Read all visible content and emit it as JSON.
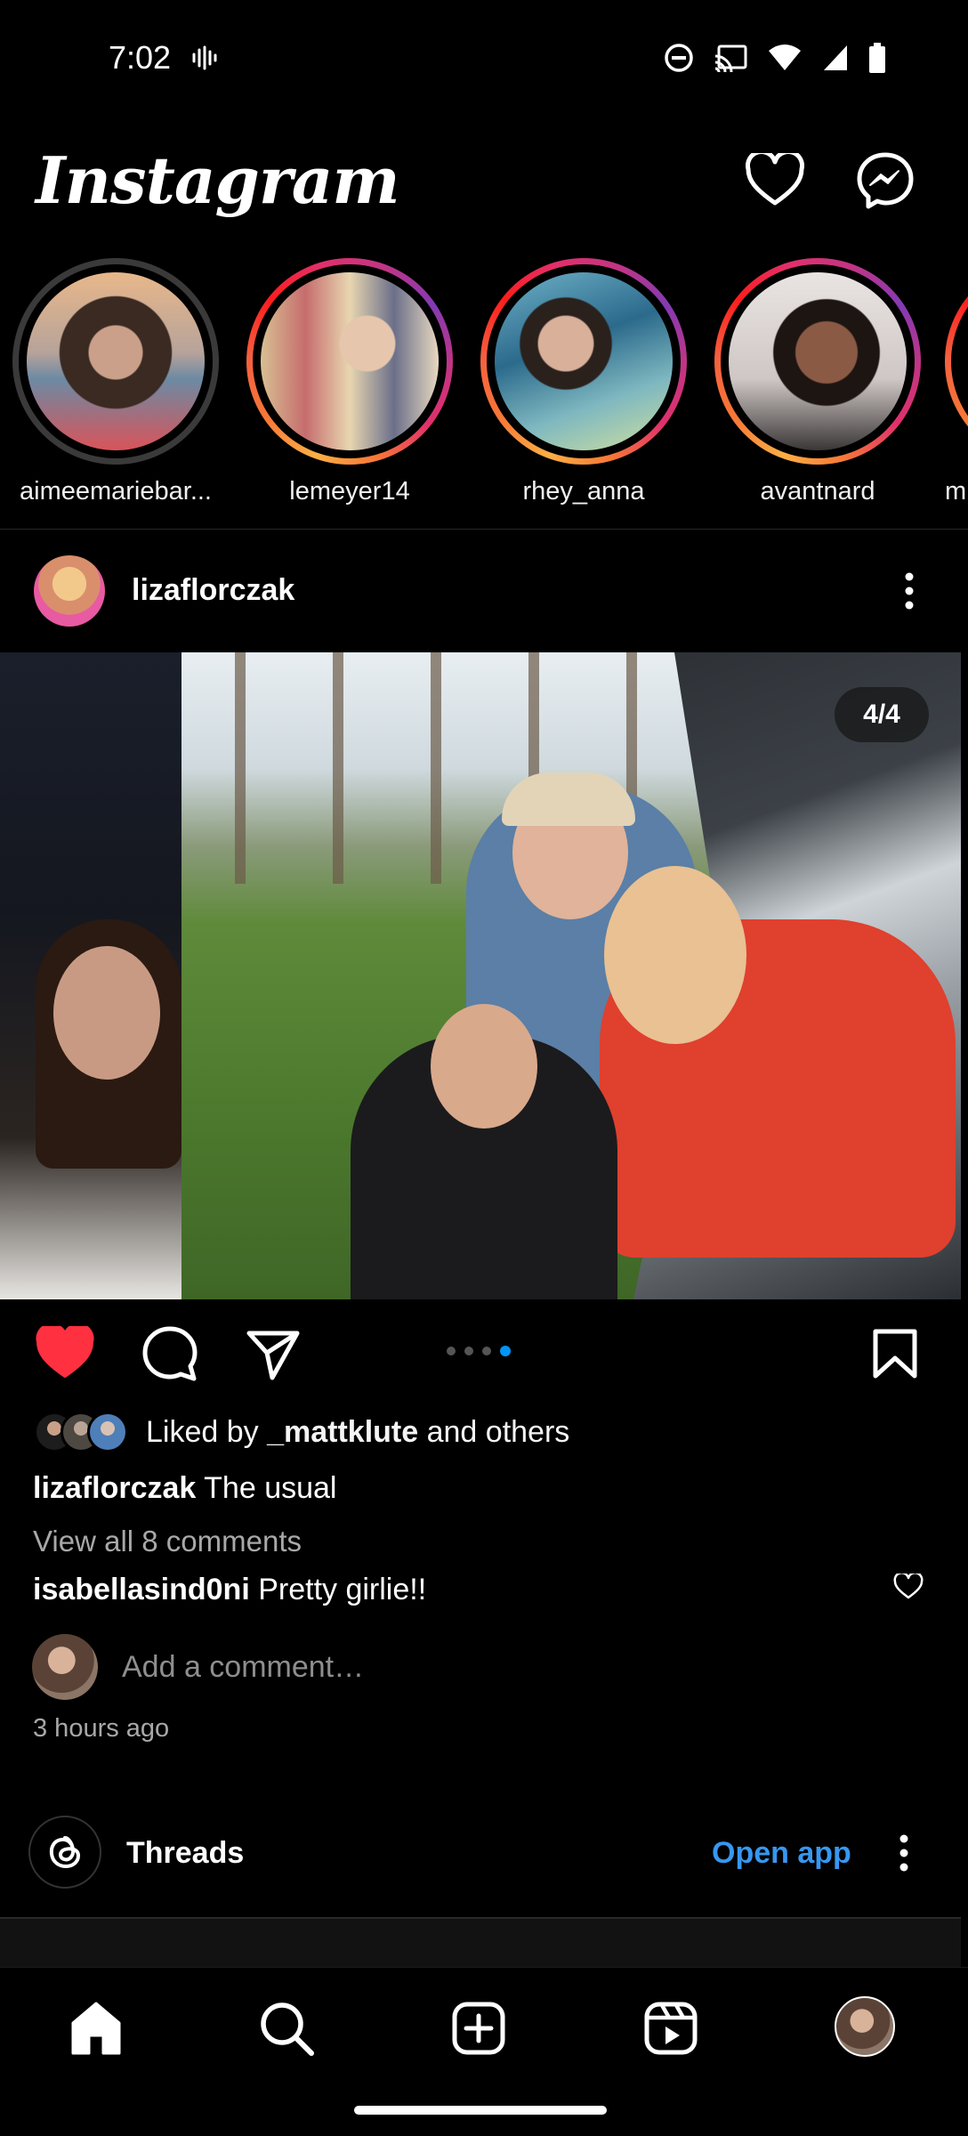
{
  "status_bar": {
    "time": "7:02"
  },
  "header": {
    "logo": "Instagram"
  },
  "stories": [
    {
      "username": "aimeemariebar...",
      "state": "seen"
    },
    {
      "username": "lemeyer14",
      "state": "new"
    },
    {
      "username": "rhey_anna",
      "state": "new"
    },
    {
      "username": "avantnard",
      "state": "new"
    },
    {
      "username": "m",
      "state": "new"
    }
  ],
  "post": {
    "username": "lizaflorczak",
    "counter": "4/4",
    "carousel": {
      "count": 4,
      "active": 4
    },
    "liked": true,
    "likes": {
      "prefix": "Liked by",
      "user": "_mattklute",
      "suffix": "and others"
    },
    "caption": {
      "user": "lizaflorczak",
      "text": "The usual"
    },
    "view_all": "View all 8 comments",
    "comment": {
      "user": "isabellasind0ni",
      "text": "Pretty girlie!!"
    },
    "add_comment_placeholder": "Add a comment…",
    "time_ago": "3 hours ago"
  },
  "threads": {
    "label": "Threads",
    "action": "Open app"
  },
  "colors": {
    "accent": "#0095f6",
    "like": "#ff3040",
    "link": "#3797f0"
  },
  "icons": [
    "heart-icon",
    "messenger-icon",
    "more-icon",
    "comment-icon",
    "share-icon",
    "bookmark-icon",
    "home-icon",
    "search-icon",
    "create-icon",
    "reels-icon",
    "threads-icon"
  ]
}
